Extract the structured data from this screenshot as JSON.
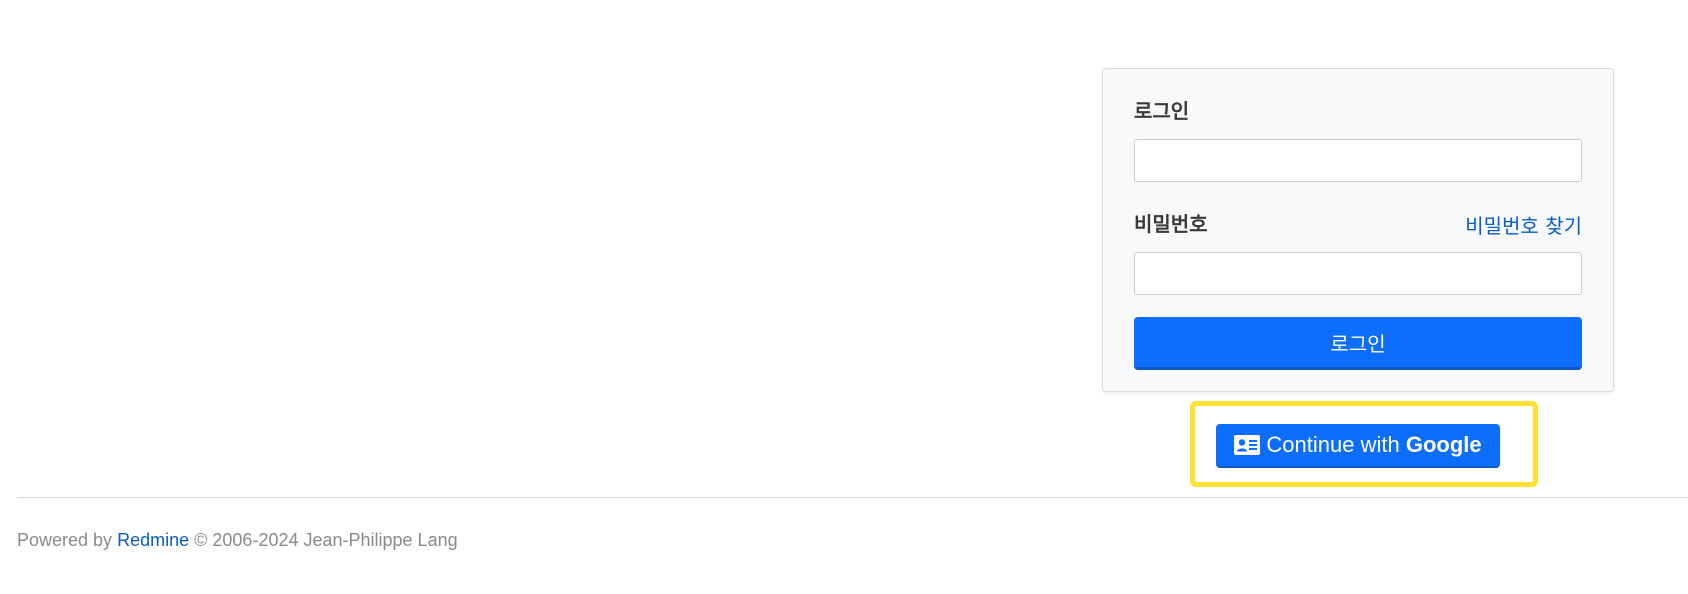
{
  "login_form": {
    "username_label": "로그인",
    "username_value": "",
    "password_label": "비밀번호",
    "password_value": "",
    "lost_password_link": "비밀번호 찾기",
    "submit_label": "로그인"
  },
  "oauth": {
    "prefix": "Continue with",
    "provider": "Google",
    "icon": "id-card-icon"
  },
  "footer": {
    "powered_by": "Powered by",
    "link_text": "Redmine",
    "copyright": "© 2006-2024 Jean-Philippe Lang"
  },
  "colors": {
    "accent": "#0d6efd",
    "link": "#0b5bc4",
    "highlight": "#ffe033"
  }
}
